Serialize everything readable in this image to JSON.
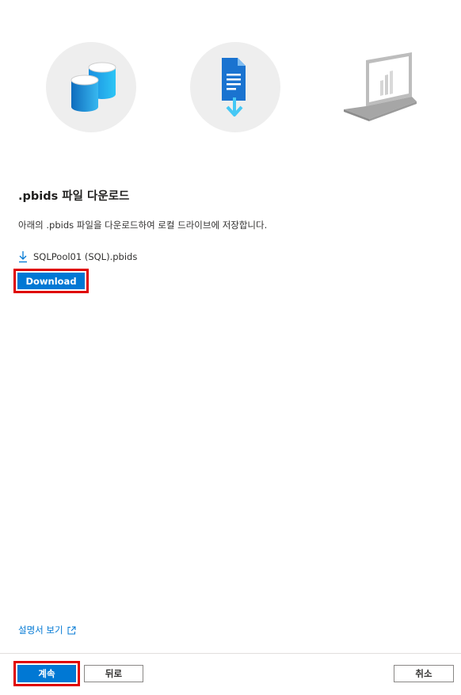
{
  "section": {
    "title": ".pbids 파일 다운로드",
    "description": "아래의 .pbids 파일을 다운로드하여 로컬 드라이브에 저장합니다."
  },
  "file": {
    "name": "SQLPool01 (SQL).pbids",
    "download_label": "Download"
  },
  "docs_link": {
    "label": "설명서 보기"
  },
  "footer": {
    "continue_label": "계속",
    "back_label": "뒤로",
    "cancel_label": "취소"
  },
  "icons": {
    "step1": "database-icon",
    "step2": "file-download-icon",
    "step3": "laptop-icon",
    "file_download": "download-arrow-icon",
    "external_link": "external-link-icon"
  },
  "colors": {
    "accent": "#0078d4",
    "highlight": "#e00000",
    "circle_bg": "#eeeeee"
  }
}
